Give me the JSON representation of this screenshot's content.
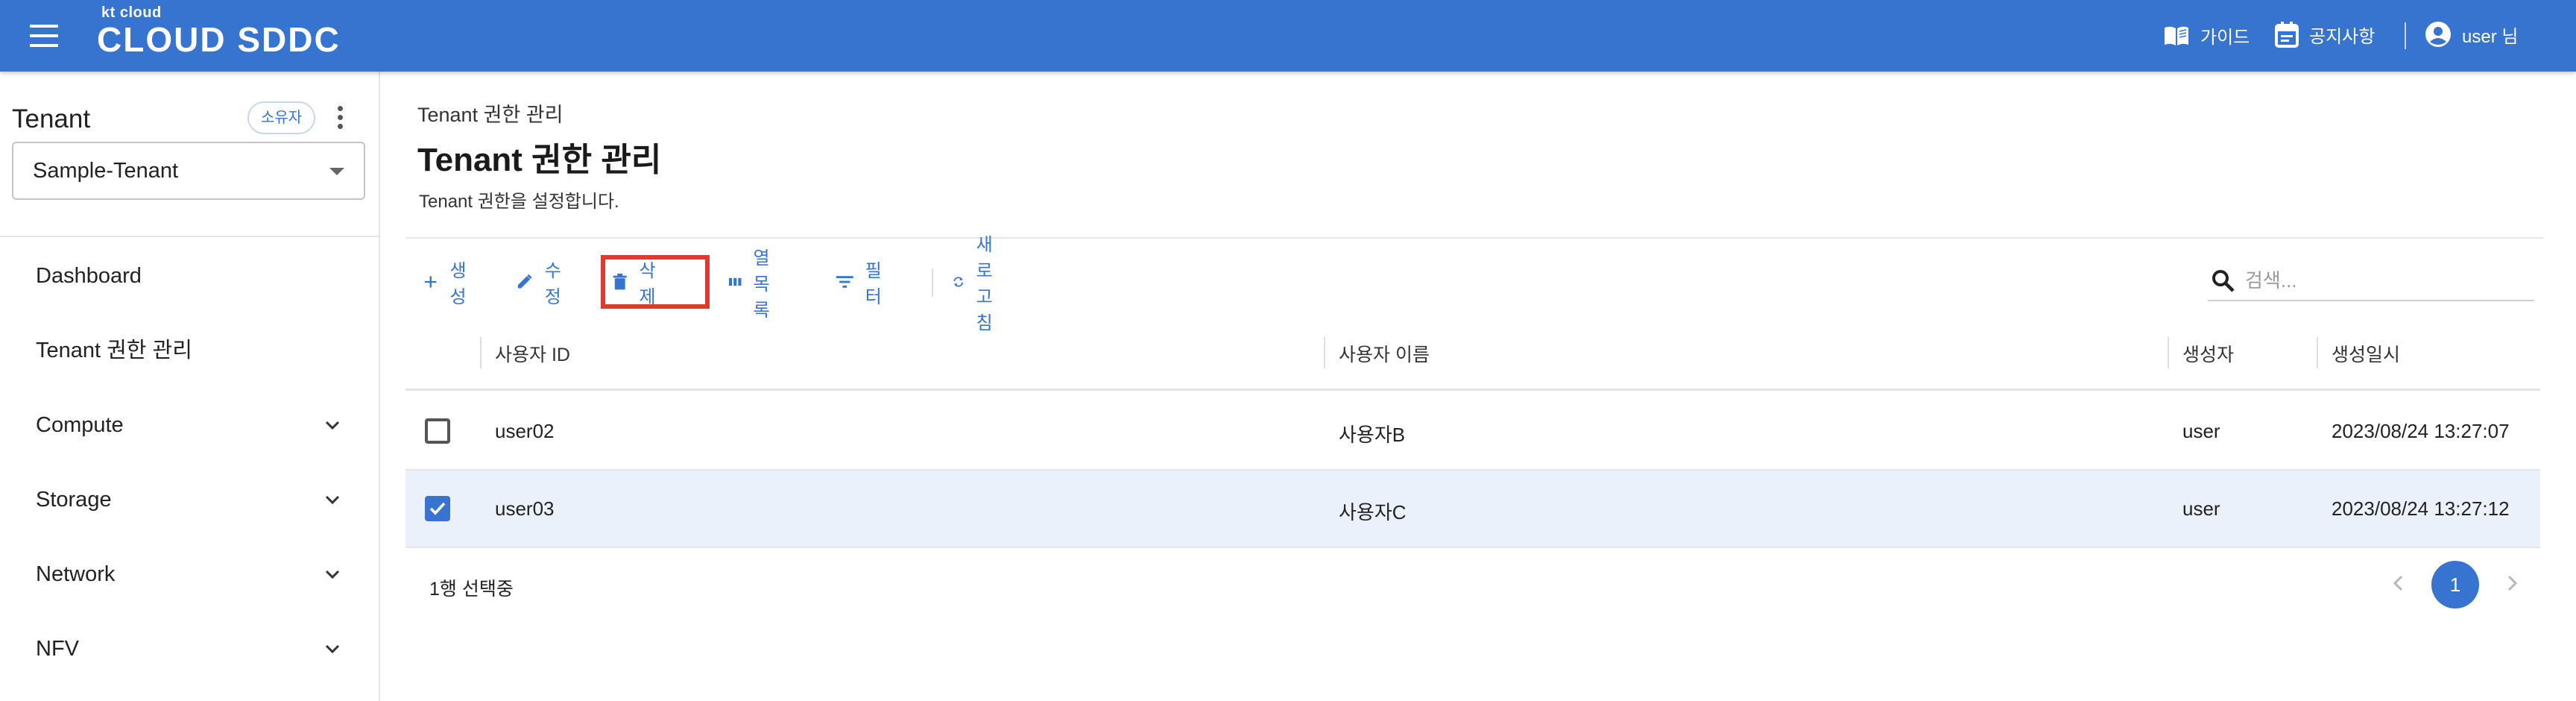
{
  "header": {
    "logo_small": "kt cloud",
    "logo_main": "CLOUD SDDC",
    "guide_label": "가이드",
    "notice_label": "공지사항",
    "user_label": "user 님",
    "bg_color": "#3774d0"
  },
  "sidebar": {
    "title": "Tenant",
    "owner_badge": "소유자",
    "tenant_selected": "Sample-Tenant",
    "items": [
      {
        "label": "Dashboard",
        "expandable": false
      },
      {
        "label": "Tenant 권한 관리",
        "expandable": false
      },
      {
        "label": "Compute",
        "expandable": true
      },
      {
        "label": "Storage",
        "expandable": true
      },
      {
        "label": "Network",
        "expandable": true
      },
      {
        "label": "NFV",
        "expandable": true
      }
    ]
  },
  "main": {
    "breadcrumb": "Tenant 권한 관리",
    "title": "Tenant 권한 관리",
    "description": "Tenant 권한을 설정합니다."
  },
  "toolbar": {
    "create_label": "생성",
    "edit_label": "수정",
    "delete_label": "삭제",
    "columns_label": "열 목록",
    "filter_label": "필터",
    "refresh_label": "새로고침",
    "search_placeholder": "검색...",
    "highlight_color": "#e03a2f"
  },
  "table": {
    "columns": [
      "사용자 ID",
      "사용자 이름",
      "생성자",
      "생성일시"
    ],
    "rows": [
      {
        "user_id": "user02",
        "user_name": "사용자B",
        "creator": "user",
        "created_at": "2023/08/24 13:27:07",
        "checked": false
      },
      {
        "user_id": "user03",
        "user_name": "사용자C",
        "creator": "user",
        "created_at": "2023/08/24 13:27:12",
        "checked": true
      }
    ]
  },
  "footer": {
    "selected_text": "1행 선택중",
    "current_page": "1"
  }
}
